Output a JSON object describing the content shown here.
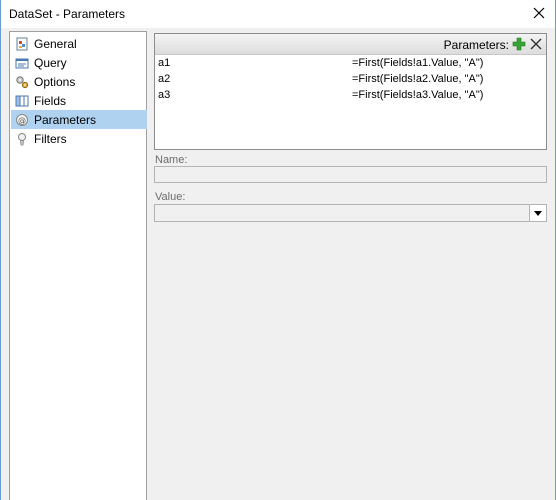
{
  "window": {
    "title": "DataSet - Parameters"
  },
  "sidebar": {
    "items": [
      {
        "label": "General",
        "icon": "general-icon"
      },
      {
        "label": "Query",
        "icon": "query-icon"
      },
      {
        "label": "Options",
        "icon": "options-icon"
      },
      {
        "label": "Fields",
        "icon": "fields-icon"
      },
      {
        "label": "Parameters",
        "icon": "parameters-icon",
        "selected": true
      },
      {
        "label": "Filters",
        "icon": "filters-icon"
      }
    ]
  },
  "parameters": {
    "header_label": "Parameters:",
    "rows": [
      {
        "name": "a1",
        "value": "=First(Fields!a1.Value, \"A\")"
      },
      {
        "name": "a2",
        "value": "=First(Fields!a2.Value, \"A\")"
      },
      {
        "name": "a3",
        "value": "=First(Fields!a3.Value, \"A\")"
      }
    ]
  },
  "form": {
    "name_label": "Name:",
    "name_value": "",
    "value_label": "Value:",
    "value_value": ""
  },
  "colors": {
    "selected_bg": "#aed2f0",
    "add_green": "#3aa335",
    "window_border": "#6b9bd2"
  }
}
